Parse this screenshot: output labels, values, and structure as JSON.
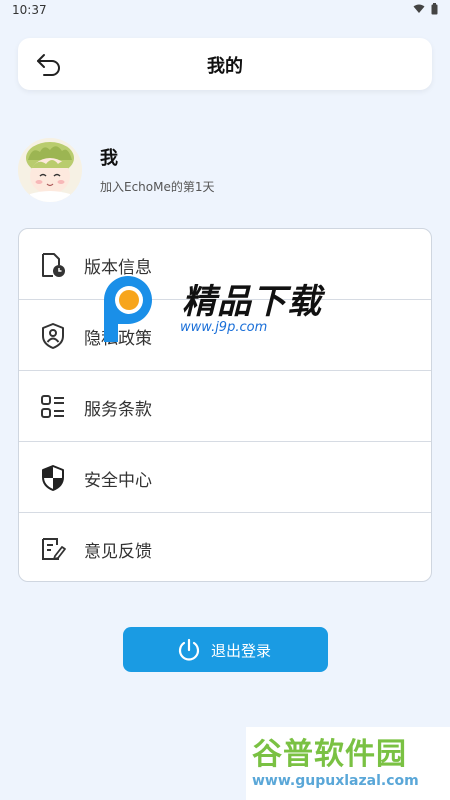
{
  "status_bar": {
    "time": "10:37",
    "icons": [
      "wifi-icon",
      "battery-icon"
    ]
  },
  "header": {
    "title": "我的",
    "back_icon": "back-arrow-icon"
  },
  "profile": {
    "name": "我",
    "join_text": "加入EchoMe的第1天"
  },
  "menu": {
    "items": [
      {
        "label": "版本信息",
        "icon": "version-info-icon"
      },
      {
        "label": "隐私政策",
        "icon": "privacy-icon"
      },
      {
        "label": "服务条款",
        "icon": "terms-icon"
      },
      {
        "label": "安全中心",
        "icon": "security-shield-icon"
      },
      {
        "label": "意见反馈",
        "icon": "feedback-icon"
      }
    ]
  },
  "logout": {
    "label": "退出登录",
    "icon": "power-icon"
  },
  "watermarks": {
    "center": {
      "title": "精品下载",
      "url": "www.j9p.com"
    },
    "corner": {
      "title": "谷普软件园",
      "url": "www.gupuxlazal.com"
    }
  },
  "colors": {
    "background": "#eef4fd",
    "accent": "#1a9be3"
  }
}
